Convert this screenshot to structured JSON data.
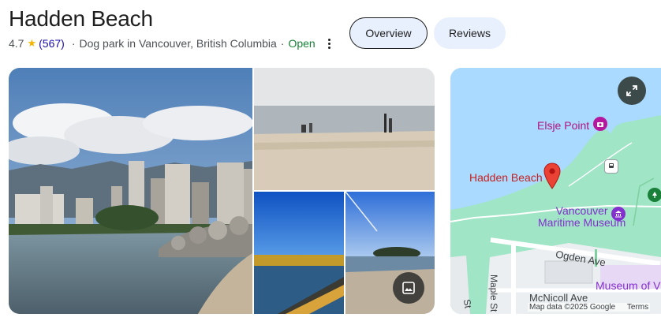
{
  "place": {
    "name": "Hadden Beach",
    "rating": "4.7",
    "review_count": "(567)",
    "category": "Dog park in Vancouver, British Columbia",
    "status": "Open"
  },
  "tabs": [
    {
      "label": "Overview",
      "selected": true
    },
    {
      "label": "Reviews",
      "selected": false
    }
  ],
  "map": {
    "labels": {
      "elsje_point": "Elsje Point",
      "hadden_beach": "Hadden Beach",
      "museum_line1": "Vancouver",
      "museum_line2": "Maritime Museum",
      "ogden_ave": "Ogden Ave",
      "mcnicoll_ave": "McNicoll Ave",
      "maple_st": "Maple St",
      "museum_of_v": "Museum of V",
      "st": "St"
    },
    "attribution": "Map data ©2025 Google",
    "terms": "Terms"
  },
  "icons": {
    "rating": "star-icon",
    "more": "more-vert-icon",
    "gallery": "image-icon",
    "expand": "expand-icon"
  },
  "colors": {
    "open": "#188038",
    "reviews_link": "#1a0dab",
    "chip_bg": "#e8f0fe",
    "star": "#f4b400",
    "pin": "#ea4335",
    "water": "#aadaff",
    "park": "#9ee3c0"
  }
}
